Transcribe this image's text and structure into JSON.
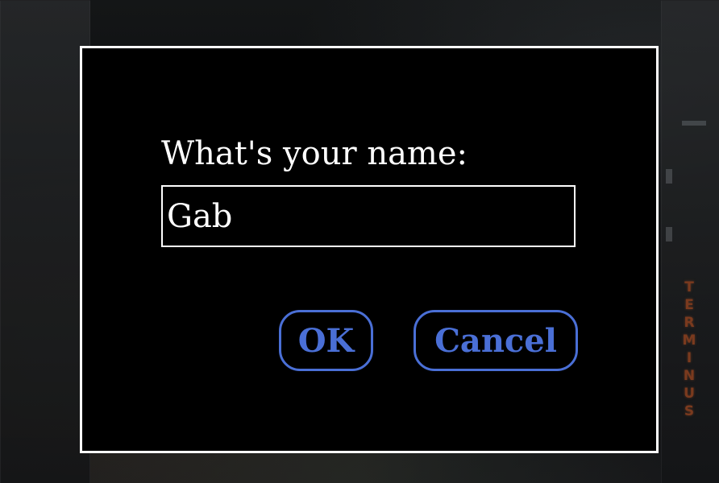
{
  "background": {
    "sign_letters": [
      "T",
      "E",
      "R",
      "M",
      "I",
      "N",
      "U",
      "S"
    ]
  },
  "dialog": {
    "prompt": "What's your name:",
    "name_value": "Gab",
    "ok_label": "OK",
    "cancel_label": "Cancel"
  },
  "colors": {
    "dialog_background": "#000000",
    "dialog_border": "#ffffff",
    "text": "#ffffff",
    "button_accent": "#4a6fd6"
  }
}
